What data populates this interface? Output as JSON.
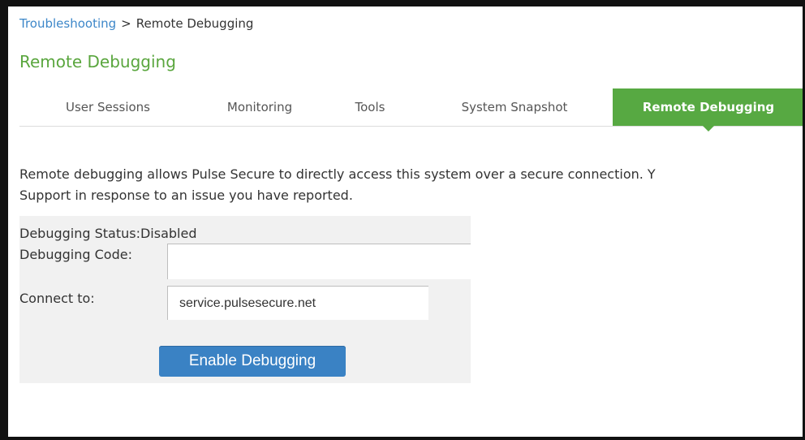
{
  "breadcrumb": {
    "parent": "Troubleshooting",
    "separator": ">",
    "current": "Remote Debugging"
  },
  "page_title": "Remote Debugging",
  "tabs": [
    {
      "label": "User Sessions",
      "active": false
    },
    {
      "label": "Monitoring",
      "active": false
    },
    {
      "label": "Tools",
      "active": false
    },
    {
      "label": "System Snapshot",
      "active": false
    },
    {
      "label": "Remote Debugging",
      "active": true
    }
  ],
  "description": {
    "line1": "Remote debugging allows Pulse Secure to directly access this system over a secure connection. Y",
    "line2": "Support in response to an issue you have reported."
  },
  "form": {
    "status_label": "Debugging Status:",
    "status_value": "Disabled",
    "code_label": "Debugging Code:",
    "code_value": "",
    "connect_label": "Connect to:",
    "connect_value": "service.pulsesecure.net",
    "enable_button": "Enable Debugging"
  },
  "colors": {
    "accent_green": "#57a942",
    "title_green": "#5aa63e",
    "link_blue": "#3d87c9",
    "button_blue": "#3a82c4"
  }
}
